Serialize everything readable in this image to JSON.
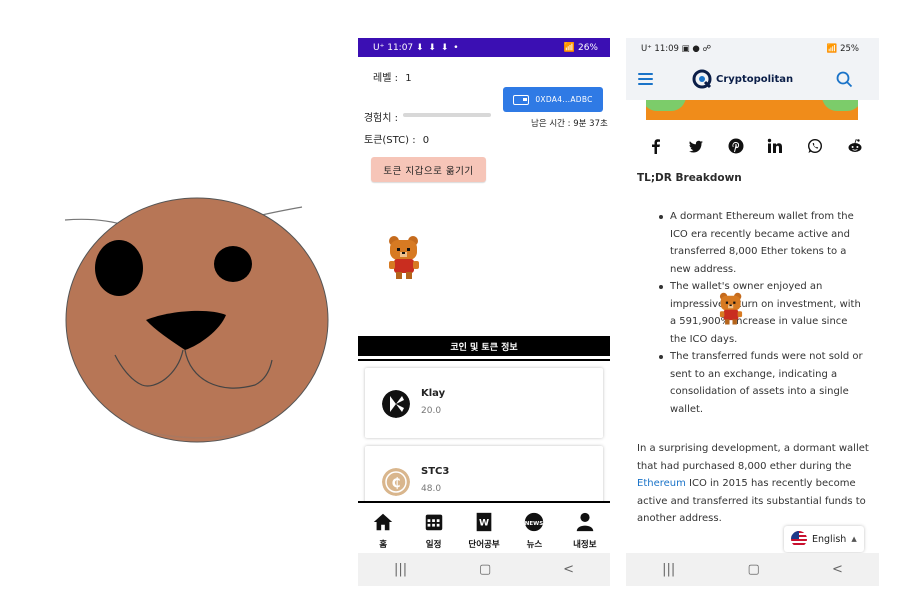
{
  "game_screen": {
    "status": {
      "time": "11:07",
      "icons": "⬇ ⬇ ⬇  •",
      "battery": "26%"
    },
    "level_label": "레벨 :",
    "level_value": "1",
    "xp_label": "경험치 :",
    "xp_progress": 0.0,
    "token_label": "토큰(STC) :",
    "token_value": "0",
    "wallet_button": "0XDA4...ADBC",
    "remaining_time": "남은 시간 : 9분 37초",
    "move_button": "토큰 지갑으로 옮기기",
    "section_title": "코인 및 토큰 정보",
    "coins": [
      {
        "name": "Klay",
        "value": "20.0"
      },
      {
        "name": "STC3",
        "value": "48.0"
      }
    ],
    "nav": [
      {
        "label": "홈",
        "icon": "home-icon"
      },
      {
        "label": "일정",
        "icon": "calendar-icon"
      },
      {
        "label": "단어공부",
        "icon": "word-book-icon"
      },
      {
        "label": "뉴스",
        "icon": "news-icon"
      },
      {
        "label": "내정보",
        "icon": "person-icon"
      }
    ]
  },
  "news_screen": {
    "status": {
      "time": "11:09",
      "battery": "25%"
    },
    "brand": "Cryptopolitan",
    "share_icons": [
      "facebook-icon",
      "twitter-icon",
      "pinterest-icon",
      "linkedin-icon",
      "whatsapp-icon",
      "reddit-icon"
    ],
    "tldr_title": "TL;DR Breakdown",
    "bullets": [
      "A dormant Ethereum wallet from the ICO era recently became active and transferred 8,000 Ether tokens to a new address.",
      "The wallet's owner enjoyed an impressive return on investment, with a 591,900% increase in value since the ICO days.",
      "The transferred funds were not sold or sent to an exchange, indicating a consolidation of assets into a single wallet."
    ],
    "para_before": "In a surprising development, a dormant wallet that had purchased 8,000 ether during the ",
    "para_link": "Ethereum",
    "para_after": " ICO in 2015 has recently become active and transferred its substantial funds to another address.",
    "language": "English"
  },
  "colors": {
    "status_purple": "#3b0fb3",
    "wallet_blue": "#2f7ae5",
    "move_button_peach": "#f6c5b8",
    "bear_brown": "#b77656",
    "link_blue": "#1a73c8"
  }
}
